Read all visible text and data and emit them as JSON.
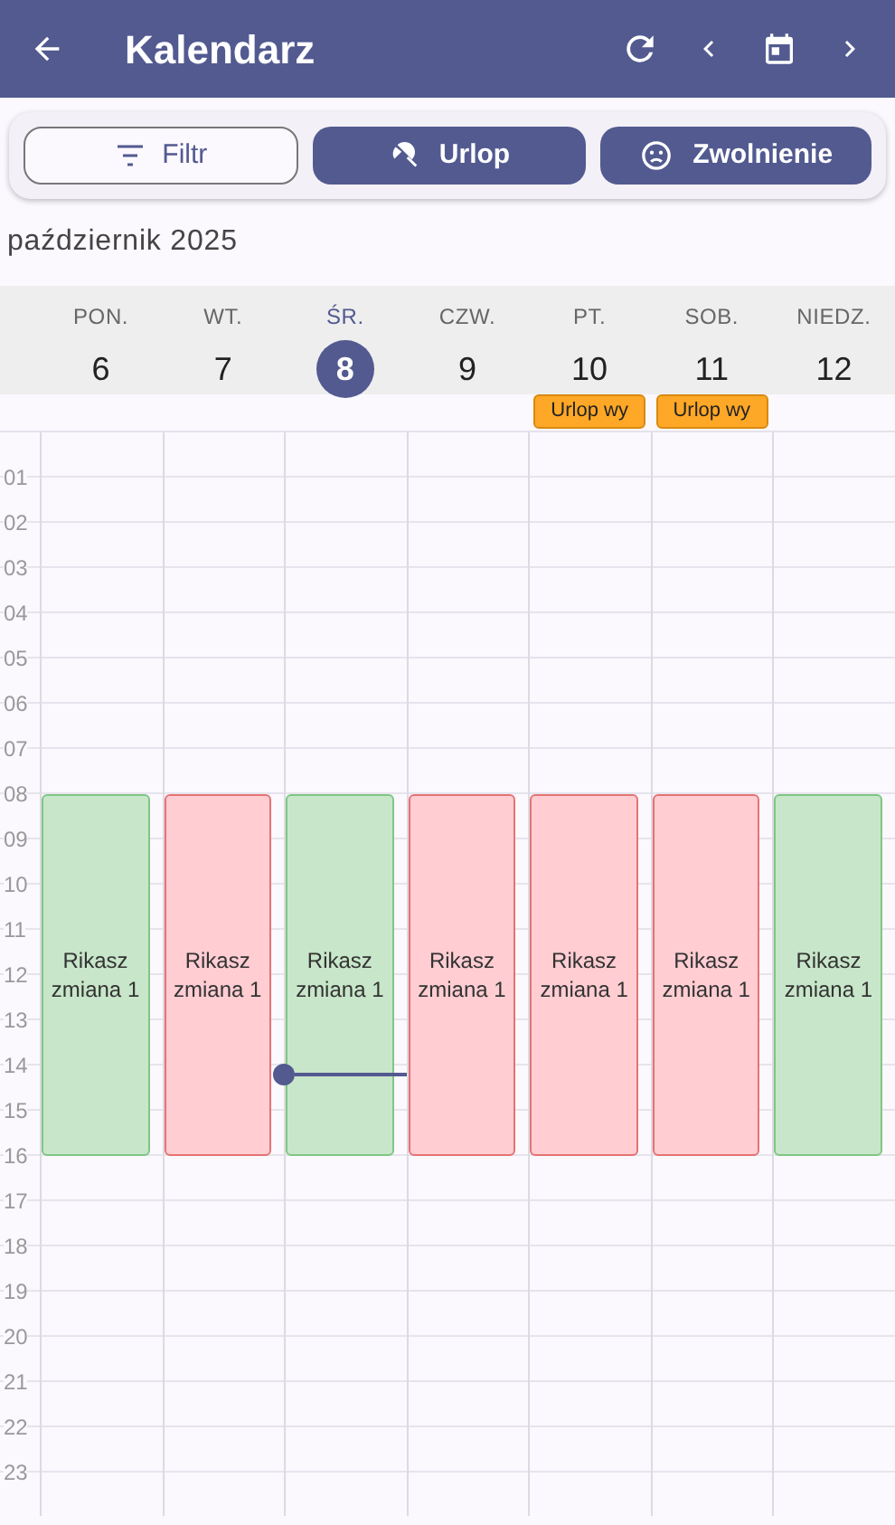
{
  "app_bar": {
    "title": "Kalendarz"
  },
  "actions": [
    {
      "label": "Filtr",
      "kind": "outline"
    },
    {
      "label": "Urlop",
      "kind": "filled"
    },
    {
      "label": "Zwolnienie",
      "kind": "filled"
    }
  ],
  "month": "październik 2025",
  "days": [
    {
      "name": "PON.",
      "number": "6",
      "selected": false,
      "events": [
        {
          "title": "Rikasz zmiana 1",
          "color": "#c8e6c9"
        }
      ]
    },
    {
      "name": "WT.",
      "number": "7",
      "selected": false,
      "events": [
        {
          "title": "Rikasz zmiana 1",
          "color": "#ffcdd2"
        }
      ]
    },
    {
      "name": "ŚR.",
      "number": "8",
      "selected": true,
      "events": [
        {
          "title": "Rikasz zmiana 1",
          "color": "#c8e6c9"
        }
      ]
    },
    {
      "name": "CZW.",
      "number": "9",
      "selected": false,
      "events": [
        {
          "title": "Rikasz zmiana 1",
          "color": "#ffcdd2"
        }
      ]
    },
    {
      "name": "PT.",
      "number": "10",
      "selected": false,
      "all_day": [
        "Urlop wy"
      ],
      "events": [
        {
          "title": "Rikasz zmiana 1",
          "color": "#ffcdd2"
        }
      ]
    },
    {
      "name": "SOB.",
      "number": "11",
      "selected": false,
      "all_day": [
        "Urlop wy"
      ],
      "events": [
        {
          "title": "Rikasz zmiana 1",
          "color": "#ffcdd2"
        }
      ]
    },
    {
      "name": "NIEDZ.",
      "number": "12",
      "selected": false,
      "events": [
        {
          "title": "Rikasz zmiana 1",
          "color": "#c8e6c9"
        }
      ]
    }
  ],
  "hours": [
    "01",
    "02",
    "03",
    "04",
    "05",
    "06",
    "07",
    "08",
    "09",
    "10",
    "11",
    "12",
    "13",
    "14",
    "15",
    "16",
    "17",
    "18",
    "19",
    "20",
    "21",
    "22",
    "23"
  ]
}
